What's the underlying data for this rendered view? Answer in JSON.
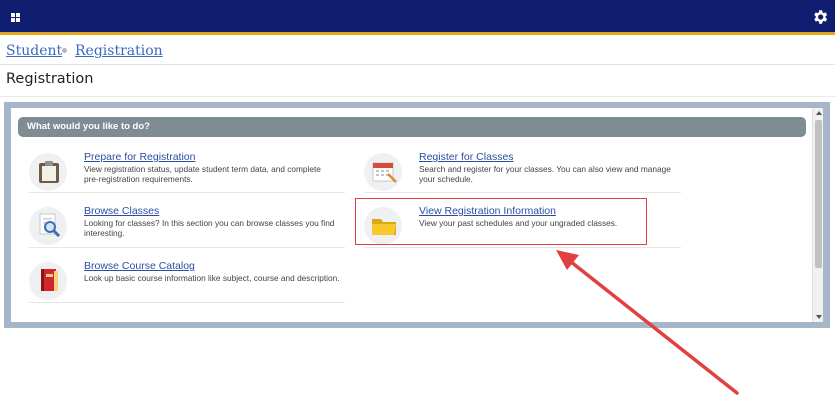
{
  "breadcrumb": {
    "items": [
      "Student",
      "Registration"
    ]
  },
  "page": {
    "title": "Registration"
  },
  "panel": {
    "header": "What would you like to do?",
    "actions": [
      {
        "title": "Prepare for Registration",
        "desc": "View registration status, update student term data, and complete pre-registration requirements.",
        "icon": "clipboard-icon"
      },
      {
        "title": "Register for Classes",
        "desc": "Search and register for your classes. You can also view and manage your schedule.",
        "icon": "calendar-icon"
      },
      {
        "title": "Browse Classes",
        "desc": "Looking for classes? In this section you can browse classes you find interesting.",
        "icon": "magnifier-document-icon"
      },
      {
        "title": "View Registration Information",
        "desc": "View your past schedules and your ungraded classes.",
        "icon": "folder-icon"
      },
      {
        "title": "Browse Course Catalog",
        "desc": "Look up basic course information like subject, course and description.",
        "icon": "book-icon"
      }
    ]
  },
  "colors": {
    "topbar": "#0f1e70",
    "accent": "#e2a820",
    "link": "#2b4fa0",
    "highlight": "#e04040"
  }
}
